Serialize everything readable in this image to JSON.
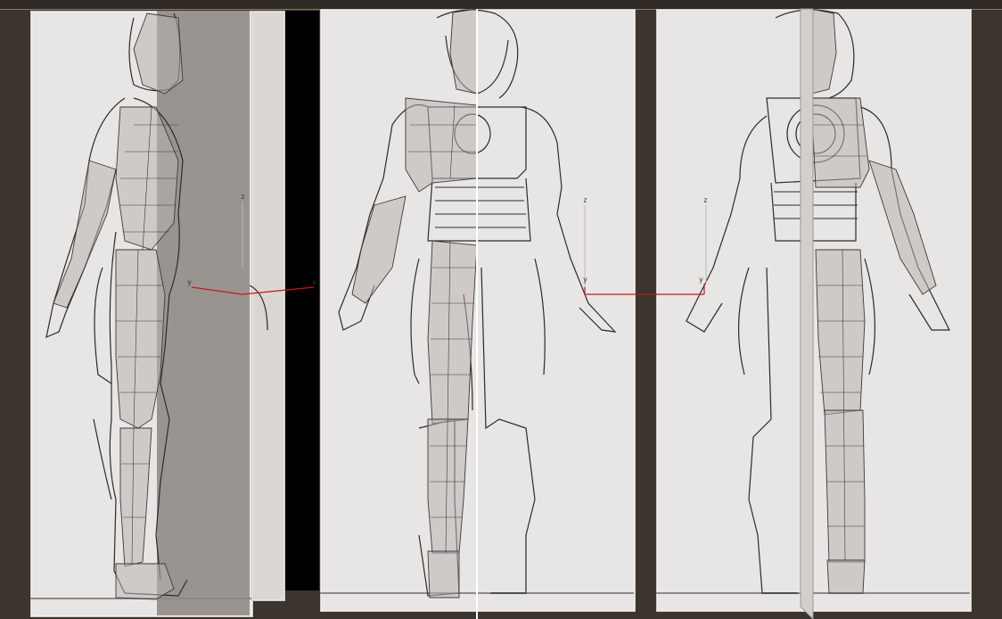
{
  "viewport": {
    "title": "",
    "views": [
      {
        "name": "side-view"
      },
      {
        "name": "front-view"
      },
      {
        "name": "back-view"
      }
    ]
  },
  "gizmos": {
    "left": {
      "z_label": "z",
      "y_label": "y",
      "x_label": "x"
    },
    "right": {
      "z_label": "z",
      "y_label": "y",
      "x_label": "y"
    },
    "back": {
      "z_label": "z",
      "y_label": "y"
    }
  },
  "colors": {
    "background": "#3b342f",
    "plane": "#e8e6e4",
    "axis": "#c81818",
    "mesh": "#b9b3b0",
    "lineart": "#2b2b2b"
  },
  "icons": [
    "reference-image-plane-icon",
    "mesh-wireframe-icon",
    "axis-gizmo-icon"
  ]
}
